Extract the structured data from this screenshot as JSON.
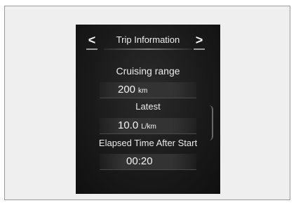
{
  "header": {
    "title": "Trip Information",
    "prev_label": "<",
    "next_label": ">"
  },
  "items": [
    {
      "label": "Cruising range",
      "value": "200",
      "unit": "km"
    },
    {
      "label": "Latest",
      "value": "10.0",
      "unit": "L/km"
    },
    {
      "label": "Elapsed Time After Start",
      "value": "00:20",
      "unit": ""
    }
  ]
}
